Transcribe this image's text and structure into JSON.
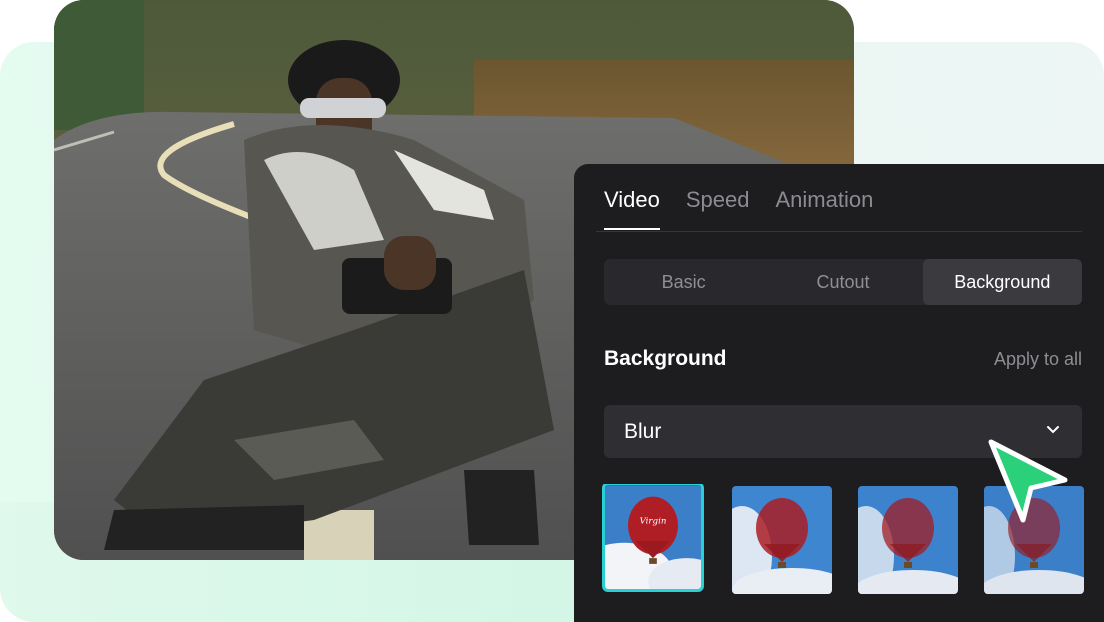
{
  "tabs": [
    {
      "label": "Video",
      "active": true
    },
    {
      "label": "Speed",
      "active": false
    },
    {
      "label": "Animation",
      "active": false
    }
  ],
  "segments": [
    {
      "label": "Basic",
      "active": false
    },
    {
      "label": "Cutout",
      "active": false
    },
    {
      "label": "Background",
      "active": true
    }
  ],
  "background_section": {
    "title": "Background",
    "apply_all": "Apply to all",
    "mode_value": "Blur"
  },
  "thumbnails": [
    {
      "name": "balloon-thumb-1",
      "selected": true
    },
    {
      "name": "balloon-thumb-2",
      "selected": false
    },
    {
      "name": "balloon-thumb-3",
      "selected": false
    },
    {
      "name": "balloon-thumb-4",
      "selected": false
    }
  ],
  "balloon_text": "Virgin",
  "colors": {
    "panel_bg": "#1d1d20",
    "accent_cyan": "#2ad1d4",
    "cursor_green": "#2bd07a",
    "backdrop_mint": "#e4fbf0"
  },
  "icons": [
    "chevron-down-icon",
    "pointer-cursor-icon"
  ]
}
